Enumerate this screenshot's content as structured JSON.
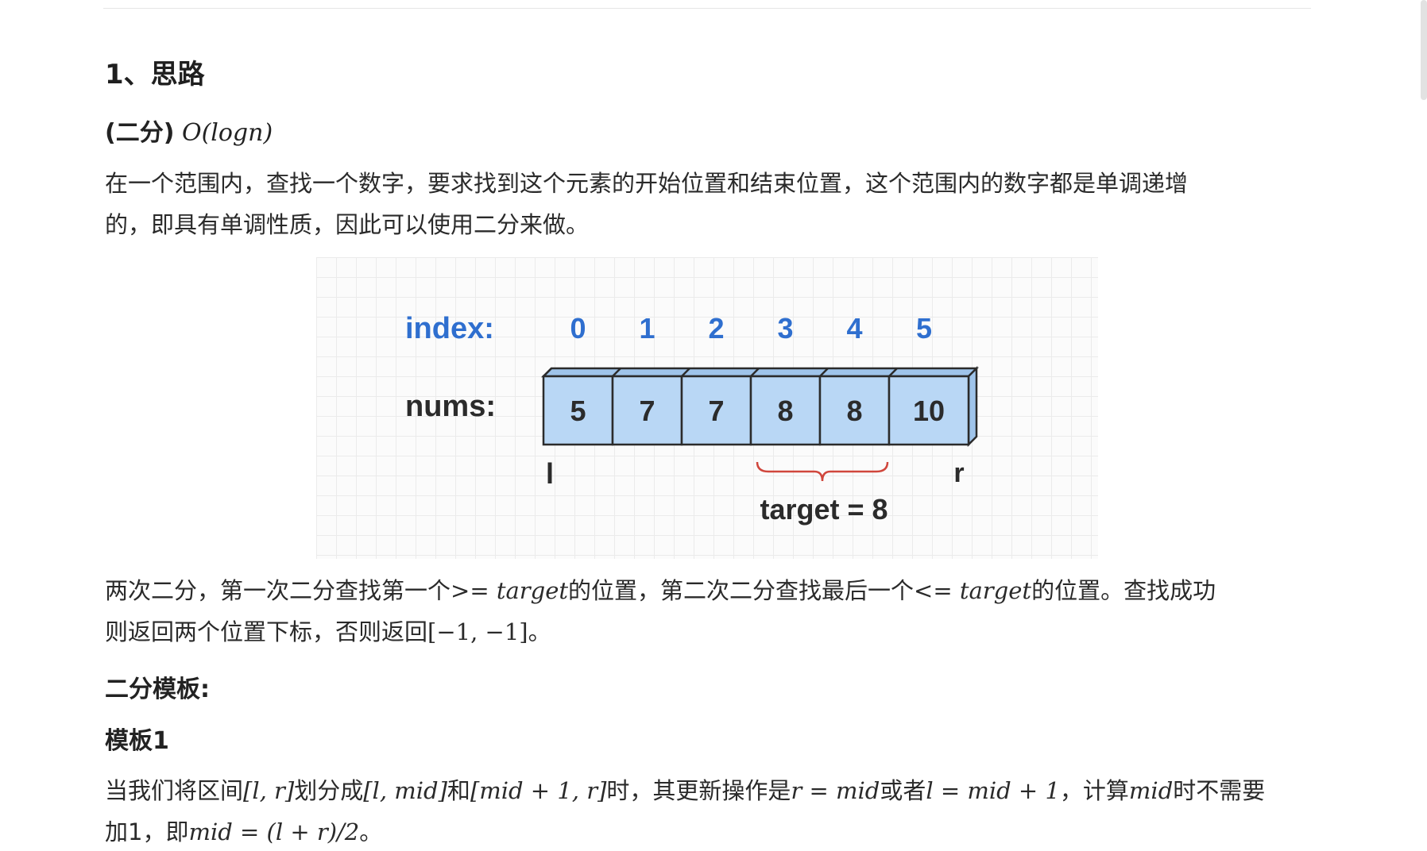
{
  "section": {
    "title": "1、思路",
    "method_label": "(二分)",
    "complexity": "O(logn)"
  },
  "intro": {
    "line1": "在一个范围内，查找一个数字，要求找到这个元素的开始位置和结束位置，这个范围内的数字都是单调递增",
    "line2": "的，即具有单调性质，因此可以使用二分来做。"
  },
  "figure": {
    "index_label": "index:",
    "nums_label": "nums:",
    "indices": [
      "0",
      "1",
      "2",
      "3",
      "4",
      "5"
    ],
    "nums": [
      "5",
      "7",
      "7",
      "8",
      "8",
      "10"
    ],
    "left_pointer": "l",
    "right_pointer": "r",
    "target_label": "target = 8",
    "colors": {
      "index_blue": "#2f6fcf",
      "cell_fill": "#b9d7f5",
      "cell_top": "#9fc4ea",
      "brace_red": "#d0463c",
      "dark": "#2b2b2b"
    }
  },
  "explain": {
    "line1": {
      "t1": "两次二分，第一次二分查找第一个",
      "m1": ">= target",
      "t2": "的位置，第二次二分查找最后一个",
      "m2": "<= target",
      "t3": "的位置。查找成功"
    },
    "line2": {
      "t1": "则返回两个位置下标，否则返回",
      "m1": "[−1, −1]",
      "t2": "。"
    }
  },
  "template_heading": "二分模板:",
  "template1_heading": "模板1",
  "template1": {
    "line1": {
      "t1": "当我们将区间",
      "m1": "[l, r]",
      "t2": "划分成",
      "m2": "[l, mid]",
      "t3": "和",
      "m3": "[mid + 1, r]",
      "t4": "时，其更新操作是",
      "m4": "r = mid",
      "t5": "或者",
      "m5": "l = mid + 1",
      "t6": "，计算",
      "m6": "mid",
      "t7": "时不需要"
    },
    "line2": {
      "t1": "加1，即",
      "m1": "mid = (l + r)/2",
      "t2": "。"
    }
  }
}
